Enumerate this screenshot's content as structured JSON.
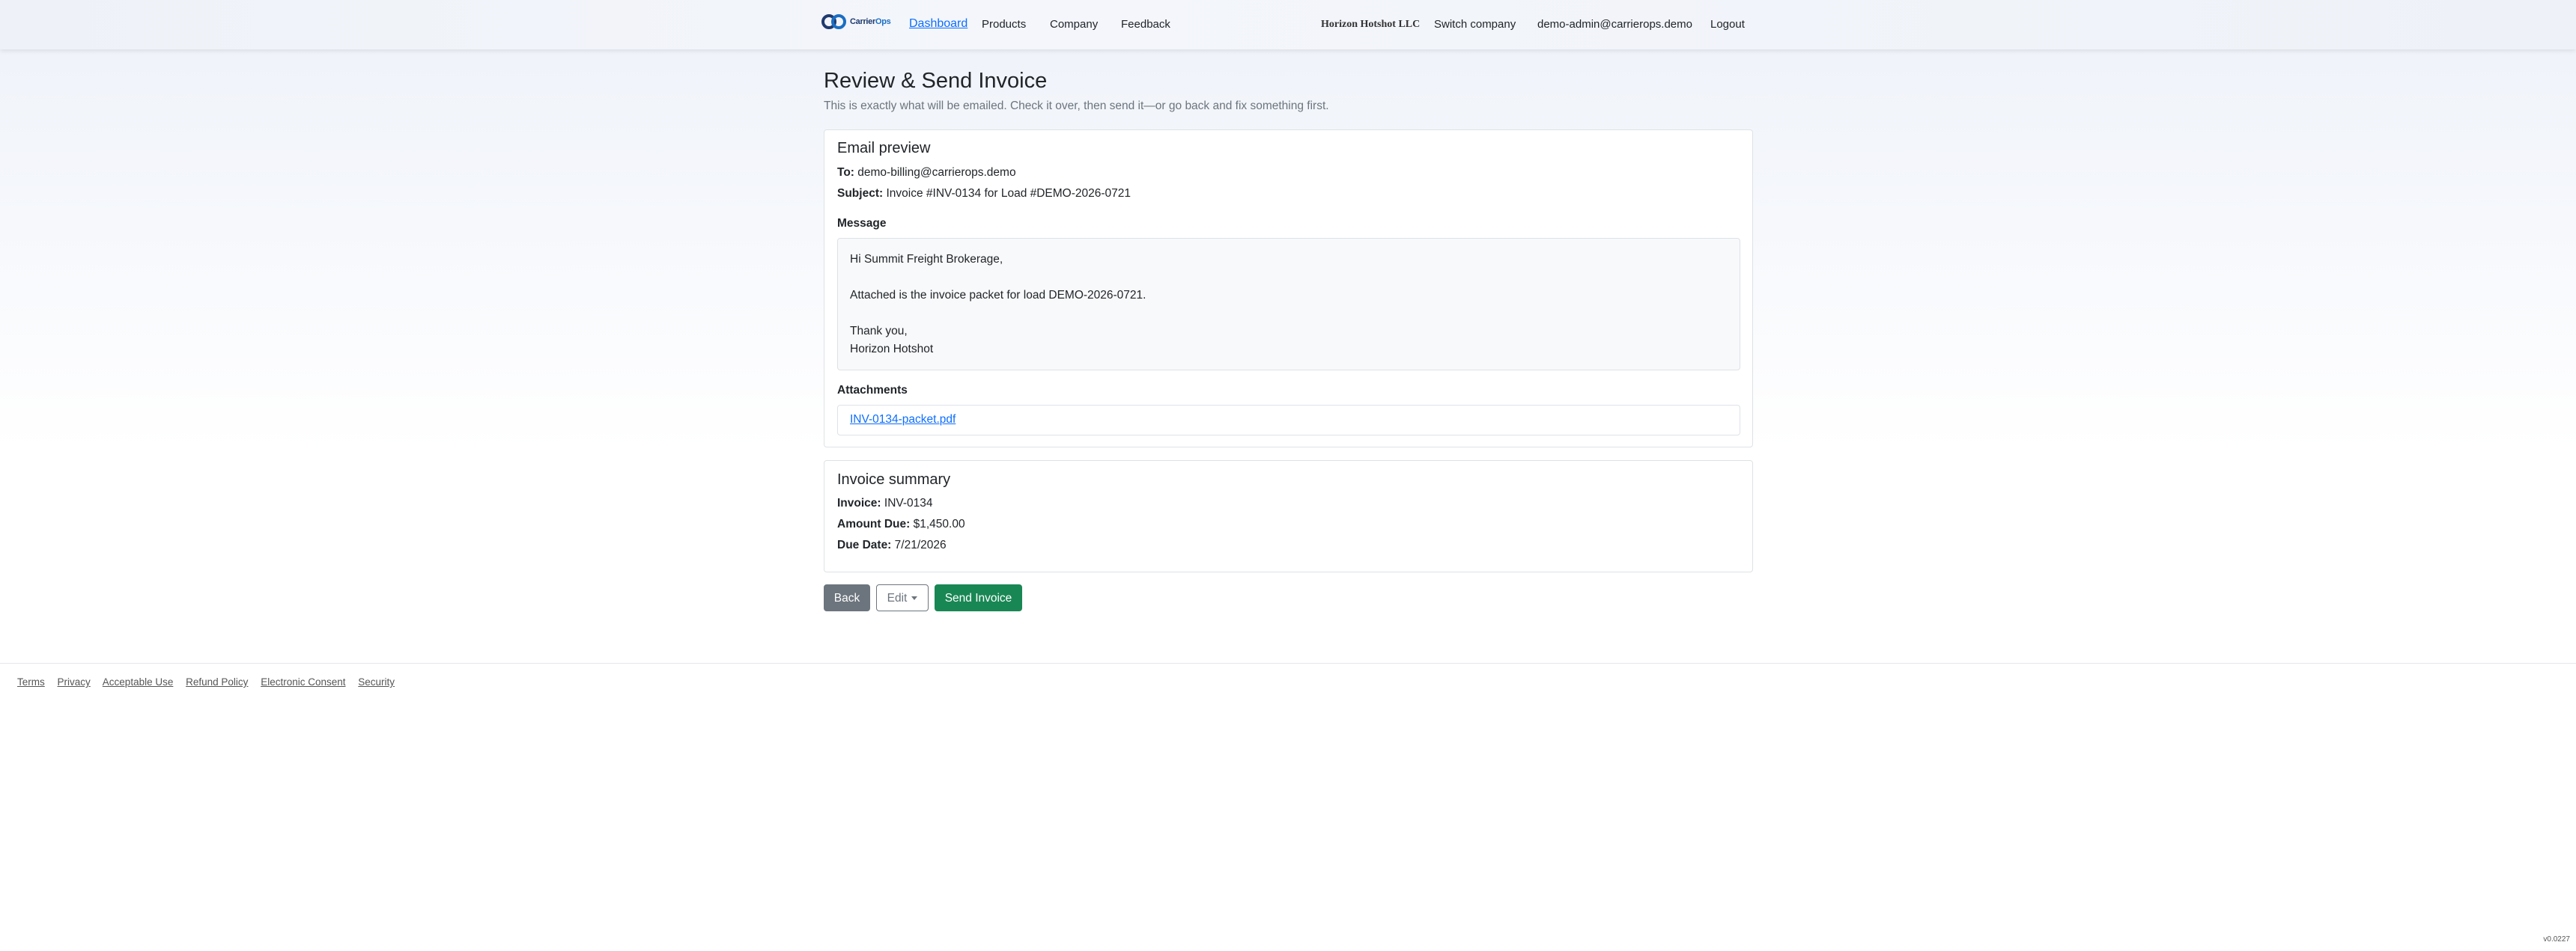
{
  "nav": {
    "brand": {
      "part1": "Carrier",
      "part2": "Ops"
    },
    "dashboard": "Dashboard",
    "products": "Products",
    "company": "Company",
    "feedback": "Feedback",
    "company_name": "Horizon Hotshot LLC",
    "switch_company": "Switch company",
    "user_email": "demo-admin@carrierops.demo",
    "logout": "Logout"
  },
  "page": {
    "title": "Review & Send Invoice",
    "subtitle": "This is exactly what will be emailed. Check it over, then send it—or go back and fix something first."
  },
  "email_preview": {
    "title": "Email preview",
    "to_label": "To:",
    "to_value": "demo-billing@carrierops.demo",
    "subject_label": "Subject:",
    "subject_value": "Invoice #INV-0134 for Load #DEMO-2026-0721",
    "message_label": "Message",
    "message_lines": {
      "greeting": "Hi Summit Freight Brokerage,",
      "body": "Attached is the invoice packet for load DEMO-2026-0721.",
      "closing": "Thank you,",
      "signature": "Horizon Hotshot"
    },
    "attachments_label": "Attachments",
    "attachment_file": "INV-0134-packet.pdf"
  },
  "invoice_summary": {
    "title": "Invoice summary",
    "invoice_label": "Invoice:",
    "invoice_value": "INV-0134",
    "amount_label": "Amount Due:",
    "amount_value": "$1,450.00",
    "due_label": "Due Date:",
    "due_value": "7/21/2026"
  },
  "actions": {
    "back": "Back",
    "edit": "Edit",
    "send": "Send Invoice"
  },
  "footer": {
    "links": [
      "Terms",
      "Privacy",
      "Acceptable Use",
      "Refund Policy",
      "Electronic Consent",
      "Security"
    ],
    "version": "v0.0227"
  },
  "colors": {
    "primary_link": "#0d6efd",
    "secondary_button": "#6c757d",
    "success_button": "#198754",
    "brand_navy": "#1f3a6e"
  }
}
